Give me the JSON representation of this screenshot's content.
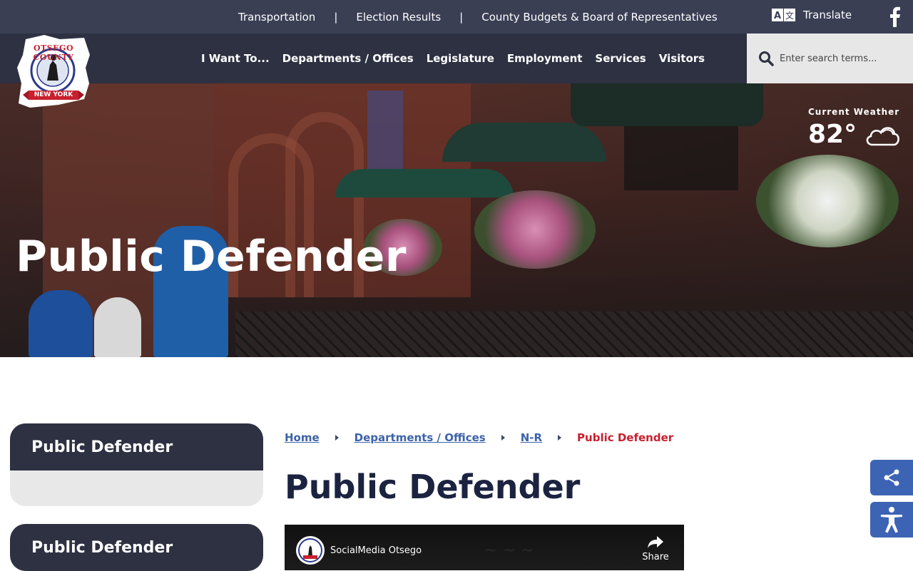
{
  "topbar": {
    "links": [
      {
        "label": "Transportation"
      },
      {
        "label": "Election Results"
      },
      {
        "label": "County Budgets & Board of Representatives"
      }
    ],
    "separator": "|",
    "translate_label": "Translate"
  },
  "nav": {
    "items": [
      {
        "label": "I Want To..."
      },
      {
        "label": "Departments / Offices"
      },
      {
        "label": "Legislature"
      },
      {
        "label": "Employment"
      },
      {
        "label": "Services"
      },
      {
        "label": "Visitors"
      }
    ]
  },
  "search": {
    "placeholder": "Enter search terms..."
  },
  "logo": {
    "top_text": "OTSEGO COUNTY",
    "banner_text": "NEW YORK"
  },
  "hero": {
    "title": "Public Defender"
  },
  "weather": {
    "label": "Current Weather",
    "temp": "82°"
  },
  "sidebar": {
    "cards": [
      {
        "title": "Public Defender"
      },
      {
        "title": "Public Defender"
      }
    ]
  },
  "breadcrumb": {
    "items": [
      {
        "label": "Home"
      },
      {
        "label": "Departments / Offices"
      },
      {
        "label": "N-R"
      }
    ],
    "current": "Public Defender"
  },
  "page": {
    "title": "Public Defender"
  },
  "video": {
    "channel": "SocialMedia Otsego",
    "share_label": "Share"
  },
  "colors": {
    "topbar": "#3a3f54",
    "nav": "#2d3142",
    "link": "#3d63a8",
    "current_crumb": "#c8202f",
    "title": "#1b2340",
    "float_button": "#3d63b4"
  }
}
